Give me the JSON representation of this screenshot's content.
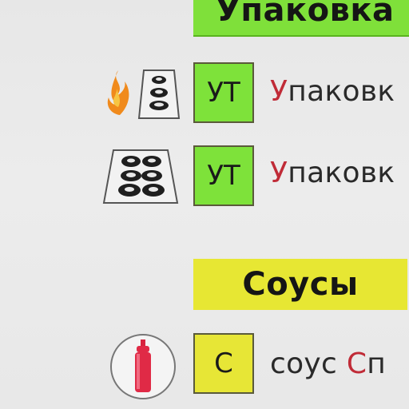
{
  "sections": {
    "packaging": {
      "title": "Упаковка",
      "color": "#7fe03a"
    },
    "sauces": {
      "title": "Соусы",
      "color": "#e7e733"
    }
  },
  "items": [
    {
      "badge": "УТ",
      "badge_color": "#7ee23a",
      "name_first": "У",
      "name_rest": "паковк",
      "icons": [
        "fire-icon",
        "sushi-tray-small-icon"
      ]
    },
    {
      "badge": "УТ",
      "badge_color": "#7ee23a",
      "name_first": "У",
      "name_rest": "паковк",
      "icons": [
        "sushi-tray-large-icon"
      ]
    },
    {
      "badge": "С",
      "badge_color": "#e7e636",
      "name_prefix": "соус ",
      "name_first": "С",
      "name_rest": "п",
      "icons": [
        "sauce-bottle-icon"
      ]
    }
  ]
}
